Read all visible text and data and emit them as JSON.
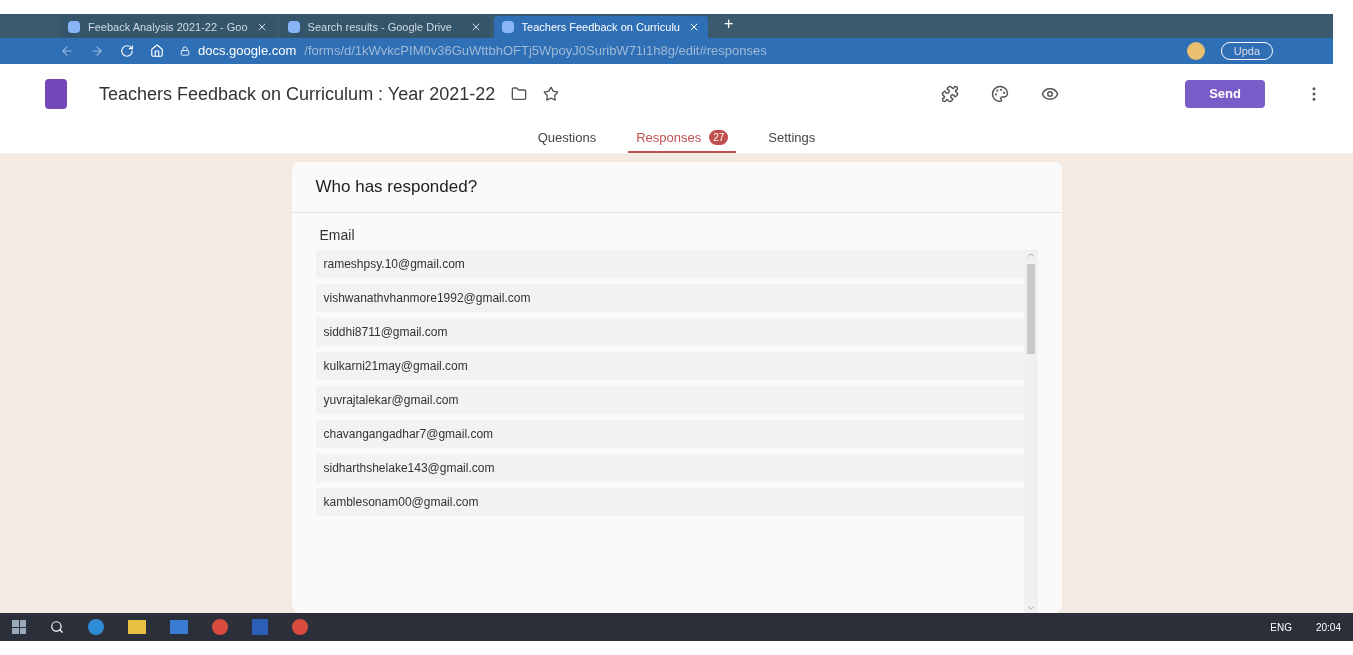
{
  "browser": {
    "tabs": [
      {
        "title": "Feeback Analysis 2021-22 - Goo",
        "selected": false
      },
      {
        "title": "Search results - Google Drive",
        "selected": false
      },
      {
        "title": "Teachers Feedback on Curriculu",
        "selected": true
      }
    ],
    "new_tab": "+",
    "url_host": "docs.google.com",
    "url_path": "/forms/d/1kWvkcPIM0v36GuWttbhOFTj5WpoyJ0SuribW71i1h8g/edit#responses",
    "update_button": "Upda"
  },
  "form": {
    "title": "Teachers Feedback on Curriculum  : Year 2021-22",
    "send_button": "Send"
  },
  "form_tabs": [
    {
      "label": "Questions",
      "selected": false
    },
    {
      "label": "Responses",
      "selected": true,
      "badge": "27"
    },
    {
      "label": "Settings",
      "selected": false
    }
  ],
  "card": {
    "title": "Who has responded?",
    "column": "Email",
    "rows": [
      "rameshpsy.10@gmail.com",
      "vishwanathvhanmore1992@gmail.com",
      "siddhi8711@gmail.com",
      "kulkarni21may@gmail.com",
      "yuvrajtalekar@gmail.com",
      "chavangangadhar7@gmail.com",
      "sidharthshelake143@gmail.com",
      "kamblesonam00@gmail.com"
    ]
  },
  "taskbar": {
    "language": "ENG",
    "time": "20:04"
  }
}
